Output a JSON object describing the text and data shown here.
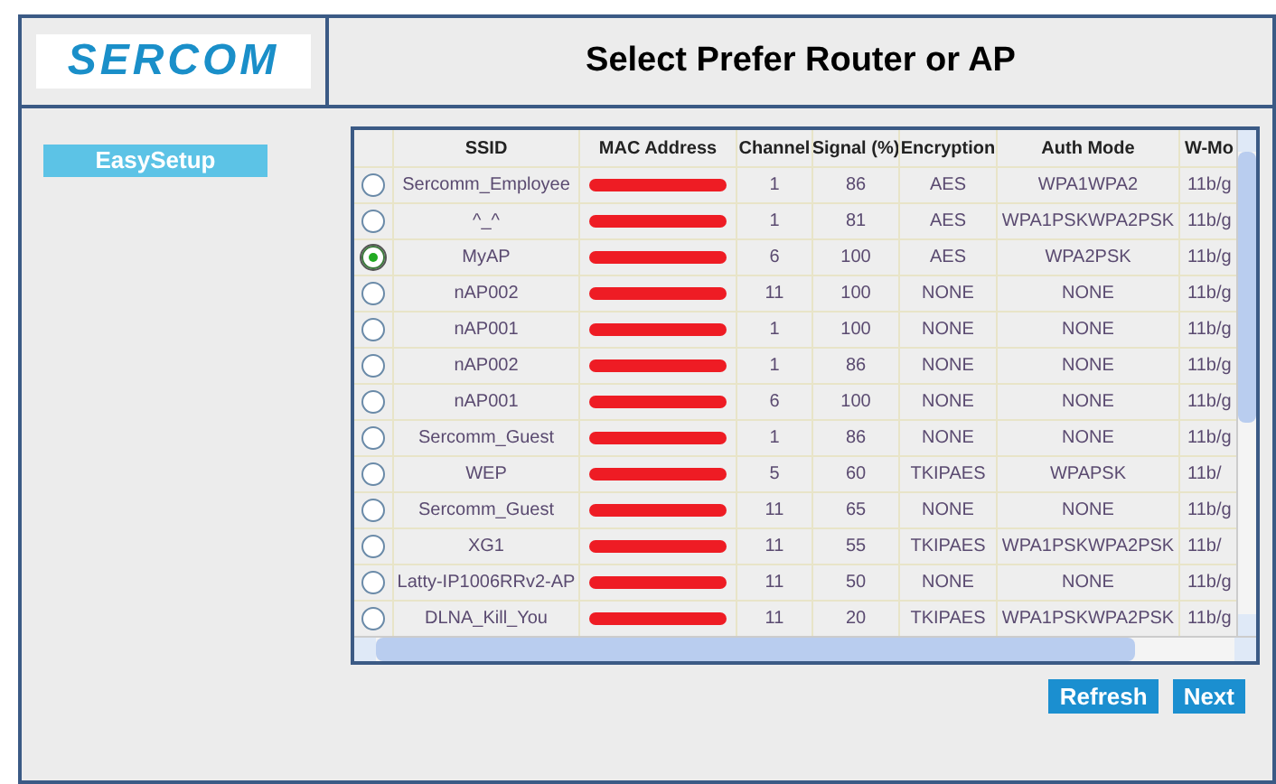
{
  "logo": "SERCOM",
  "title": "Select Prefer Router or AP",
  "sidebar": {
    "items": [
      {
        "label": "EasySetup"
      }
    ]
  },
  "table": {
    "columns": [
      "SSID",
      "MAC Address",
      "Channel",
      "Signal (%)",
      "Encryption",
      "Auth Mode",
      "W-Mo"
    ],
    "rows": [
      {
        "selected": false,
        "ssid": "Sercomm_Employee",
        "channel": "1",
        "signal": "86",
        "encryption": "AES",
        "auth": "WPA1WPA2",
        "mode": "11b/g"
      },
      {
        "selected": false,
        "ssid": "^_^",
        "channel": "1",
        "signal": "81",
        "encryption": "AES",
        "auth": "WPA1PSKWPA2PSK",
        "mode": "11b/g"
      },
      {
        "selected": true,
        "ssid": "MyAP",
        "channel": "6",
        "signal": "100",
        "encryption": "AES",
        "auth": "WPA2PSK",
        "mode": "11b/g"
      },
      {
        "selected": false,
        "ssid": "nAP002",
        "channel": "11",
        "signal": "100",
        "encryption": "NONE",
        "auth": "NONE",
        "mode": "11b/g"
      },
      {
        "selected": false,
        "ssid": "nAP001",
        "channel": "1",
        "signal": "100",
        "encryption": "NONE",
        "auth": "NONE",
        "mode": "11b/g"
      },
      {
        "selected": false,
        "ssid": "nAP002",
        "channel": "1",
        "signal": "86",
        "encryption": "NONE",
        "auth": "NONE",
        "mode": "11b/g"
      },
      {
        "selected": false,
        "ssid": "nAP001",
        "channel": "6",
        "signal": "100",
        "encryption": "NONE",
        "auth": "NONE",
        "mode": "11b/g"
      },
      {
        "selected": false,
        "ssid": "Sercomm_Guest",
        "channel": "1",
        "signal": "86",
        "encryption": "NONE",
        "auth": "NONE",
        "mode": "11b/g"
      },
      {
        "selected": false,
        "ssid": "WEP",
        "channel": "5",
        "signal": "60",
        "encryption": "TKIPAES",
        "auth": "WPAPSK",
        "mode": "11b/"
      },
      {
        "selected": false,
        "ssid": "Sercomm_Guest",
        "channel": "11",
        "signal": "65",
        "encryption": "NONE",
        "auth": "NONE",
        "mode": "11b/g"
      },
      {
        "selected": false,
        "ssid": "XG1",
        "channel": "11",
        "signal": "55",
        "encryption": "TKIPAES",
        "auth": "WPA1PSKWPA2PSK",
        "mode": "11b/"
      },
      {
        "selected": false,
        "ssid": "Latty-IP1006RRv2-AP",
        "channel": "11",
        "signal": "50",
        "encryption": "NONE",
        "auth": "NONE",
        "mode": "11b/g"
      },
      {
        "selected": false,
        "ssid": "DLNA_Kill_You",
        "channel": "11",
        "signal": "20",
        "encryption": "TKIPAES",
        "auth": "WPA1PSKWPA2PSK",
        "mode": "11b/g"
      }
    ]
  },
  "buttons": [
    "Refresh",
    "Next"
  ]
}
